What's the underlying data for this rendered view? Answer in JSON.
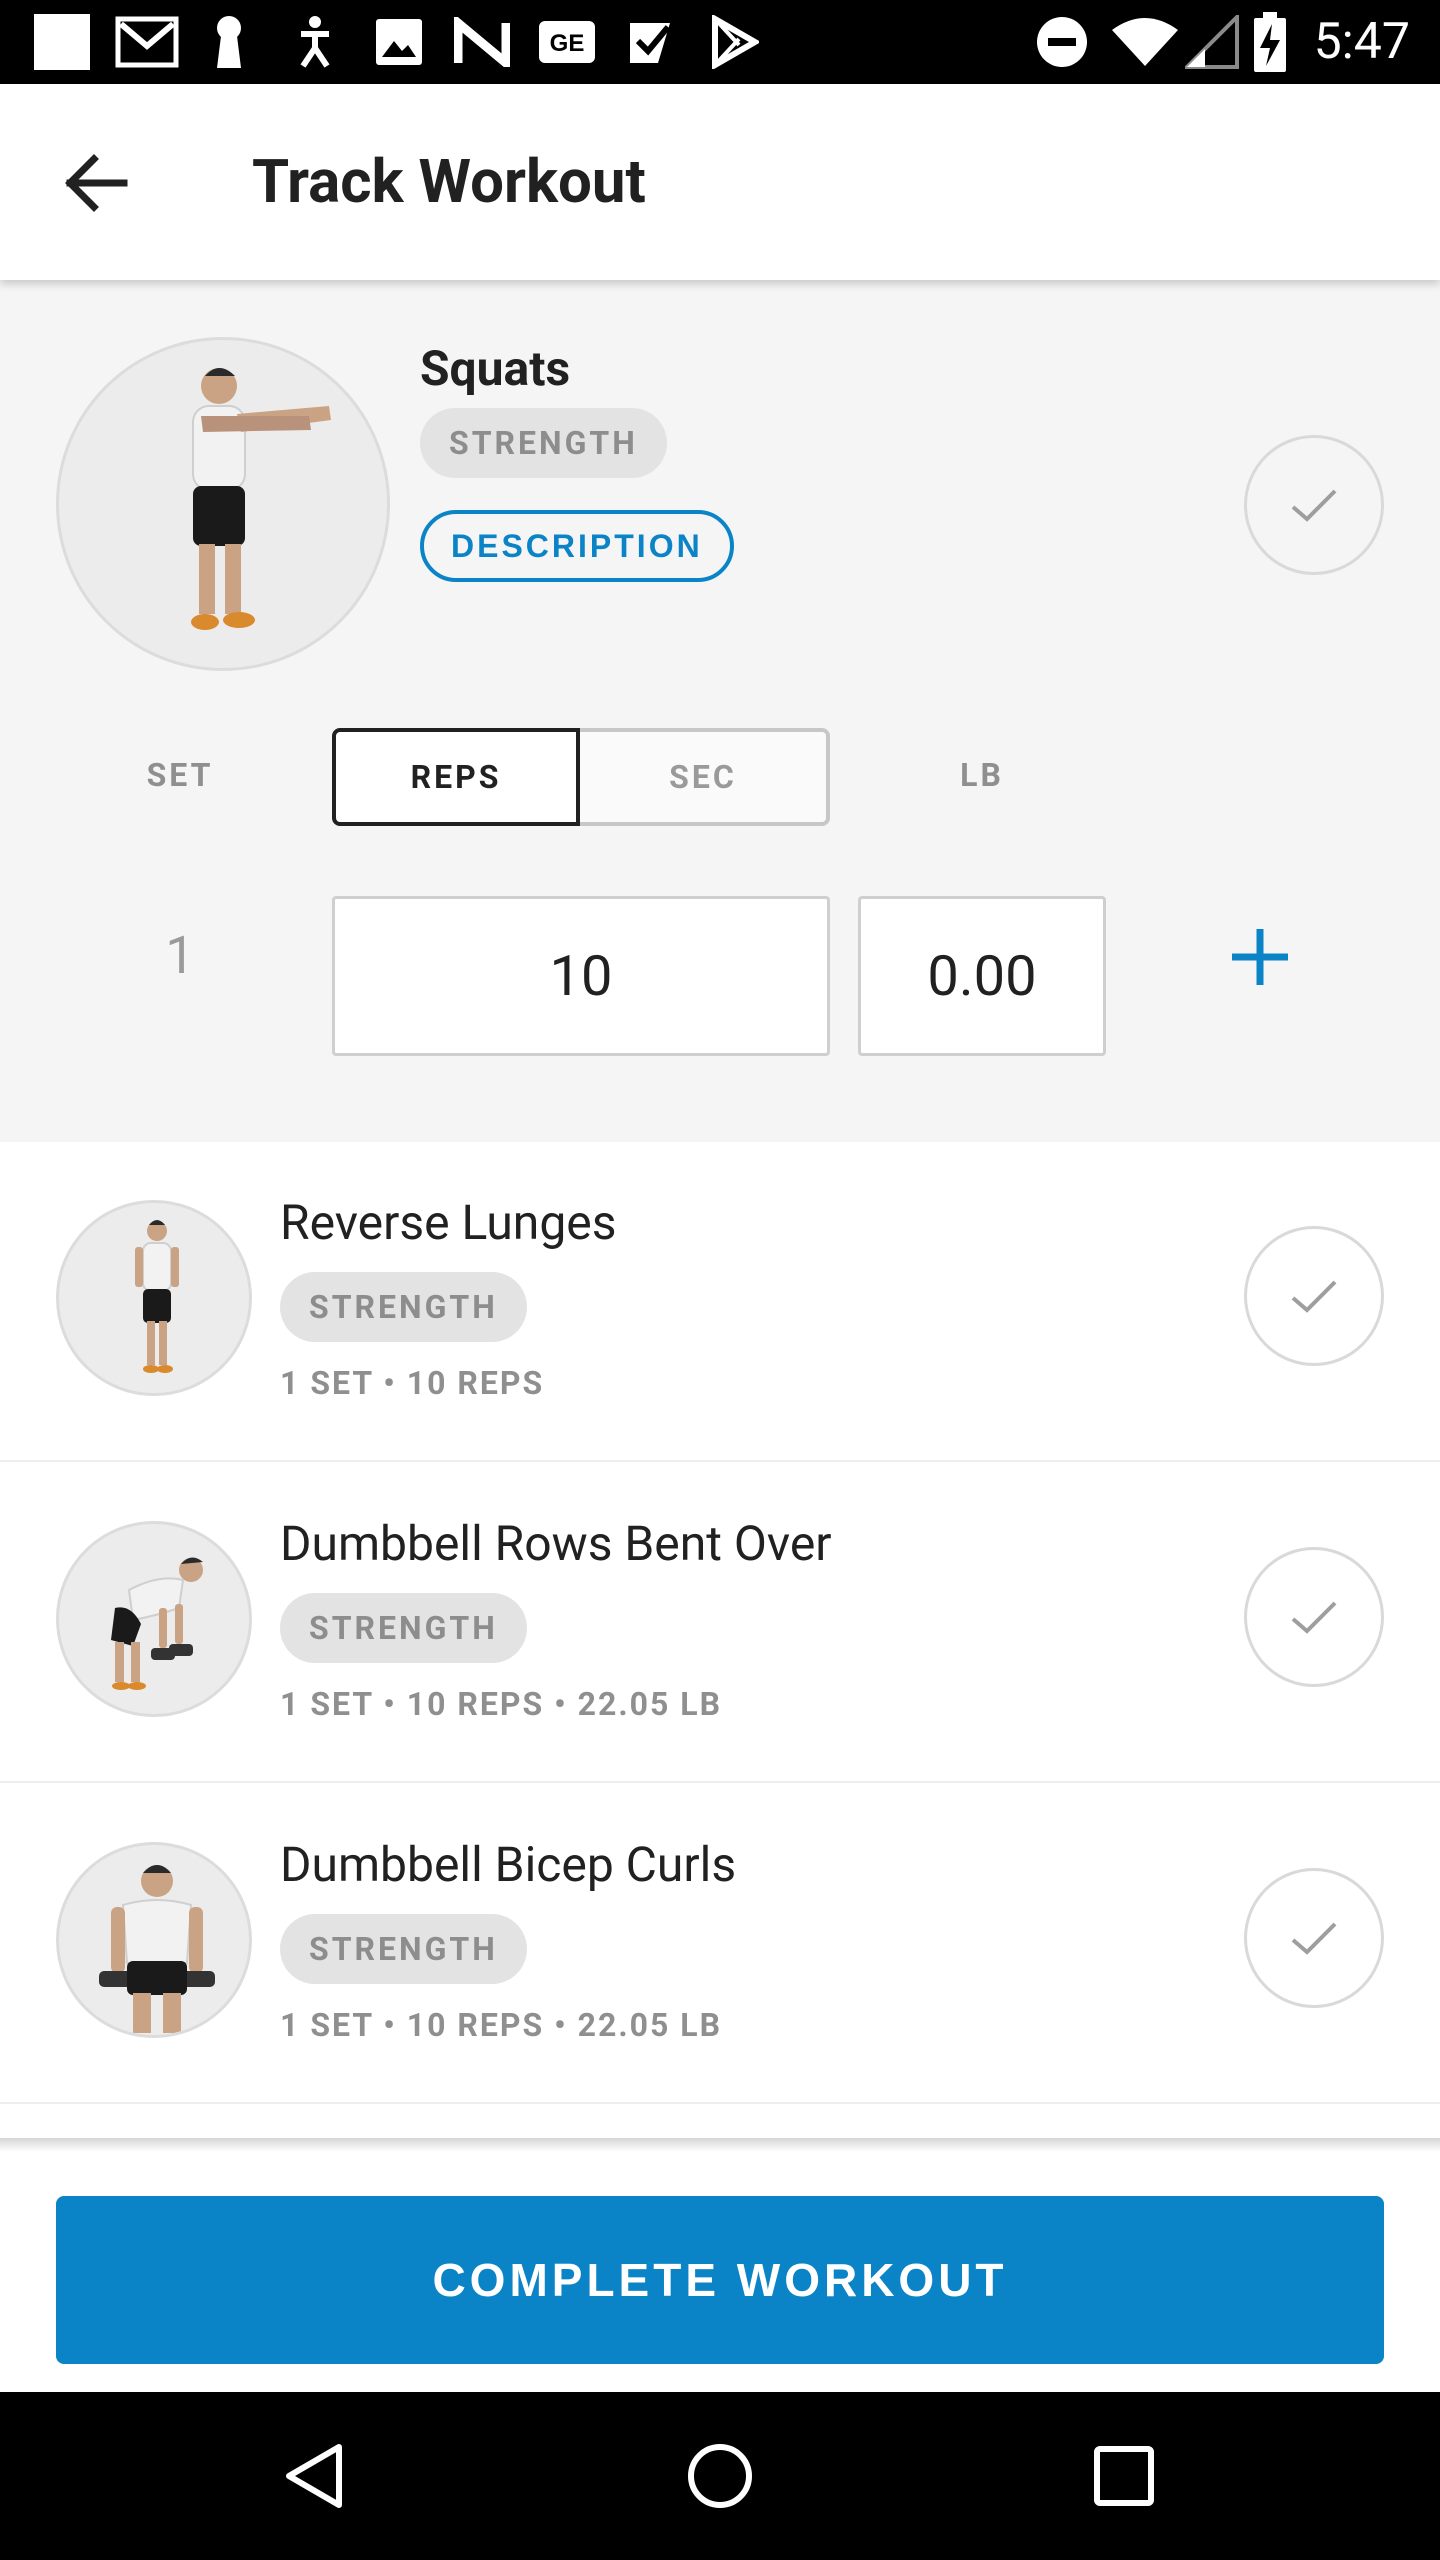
{
  "status_bar": {
    "time": "5:47",
    "left_icons": [
      "square-notification-icon",
      "gmail-icon",
      "keyhole-icon",
      "accessibility-icon",
      "image-icon",
      "n-app-icon",
      "ge-icon",
      "check-app-icon",
      "play-store-icon"
    ],
    "right_icons": [
      "do-not-disturb-icon",
      "wifi-icon",
      "cell-signal-icon",
      "battery-charging-icon"
    ]
  },
  "app_bar": {
    "title": "Track Workout"
  },
  "current_exercise": {
    "name": "Squats",
    "category": "STRENGTH",
    "description_label": "DESCRIPTION",
    "columns": {
      "set": "SET",
      "reps": "REPS",
      "sec": "SEC",
      "lb": "LB"
    },
    "selected_mode": "REPS",
    "set_number": "1",
    "reps_value": "10",
    "weight_value": "0.00"
  },
  "exercises": [
    {
      "name": "Reverse Lunges",
      "category": "STRENGTH",
      "meta": "1 SET • 10 REPS"
    },
    {
      "name": "Dumbbell Rows Bent Over",
      "category": "STRENGTH",
      "meta": "1 SET • 10 REPS   • 22.05 LB"
    },
    {
      "name": "Dumbbell Bicep Curls",
      "category": "STRENGTH",
      "meta": "1 SET • 10 REPS   • 22.05 LB"
    }
  ],
  "footer": {
    "complete_label": "COMPLETE WORKOUT"
  },
  "colors": {
    "accent": "#0a84c6",
    "panel_bg": "#f5f5f5",
    "chip_bg": "#e3e3e3",
    "muted_text": "#8f8f8f"
  }
}
